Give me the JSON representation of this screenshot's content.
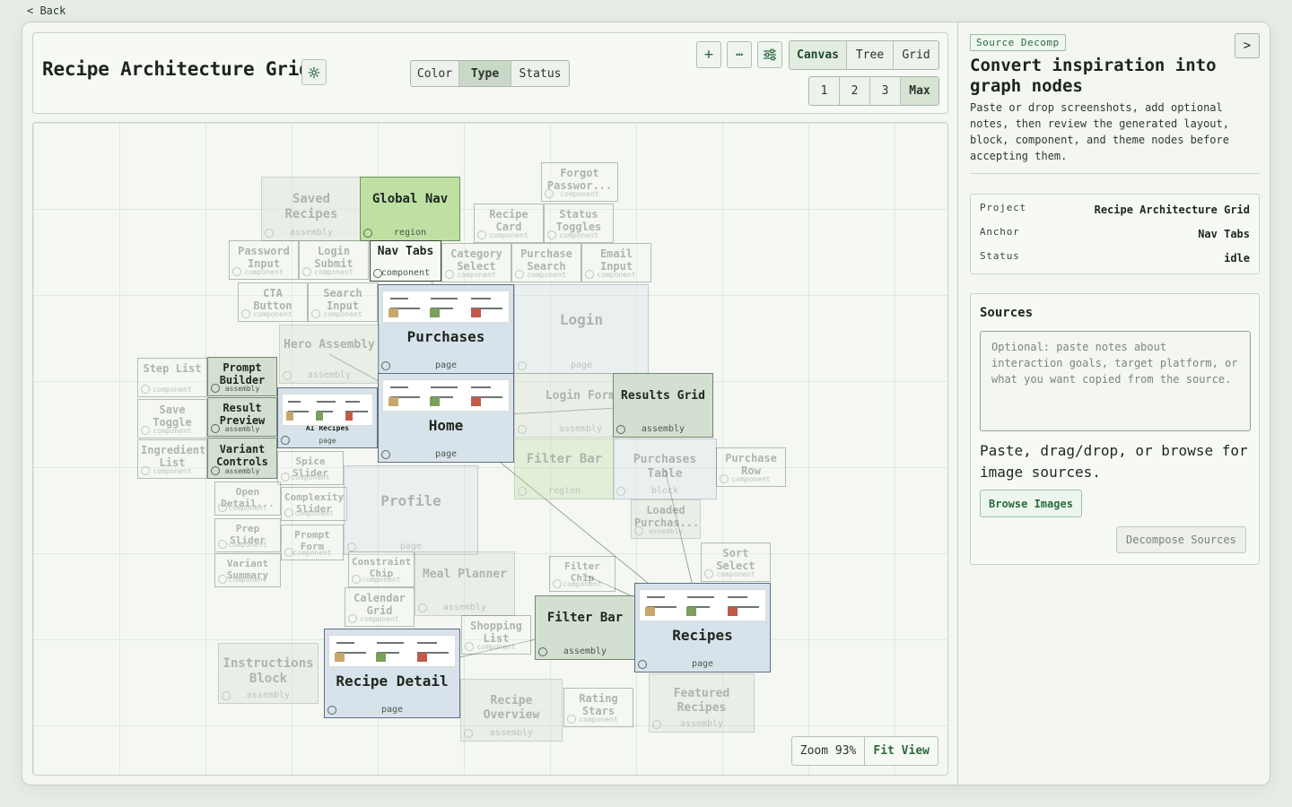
{
  "back": {
    "label": "< Back"
  },
  "header": {
    "title": "Recipe Architecture Grid",
    "color_modes": [
      {
        "label": "Color",
        "active": false
      },
      {
        "label": "Type",
        "active": true
      },
      {
        "label": "Status",
        "active": false
      }
    ],
    "actions": {
      "add": "+",
      "more": "⋯"
    },
    "view_modes": [
      {
        "label": "Canvas",
        "active": true
      },
      {
        "label": "Tree",
        "active": false
      },
      {
        "label": "Grid",
        "active": false
      }
    ],
    "depths": [
      {
        "label": "1",
        "active": false
      },
      {
        "label": "2",
        "active": false
      },
      {
        "label": "3",
        "active": false
      },
      {
        "label": "Max",
        "active": true
      }
    ]
  },
  "canvas": {
    "zoom_label": "Zoom 93%",
    "fit_label": "Fit View",
    "nodes": [
      {
        "id": "saved-recipes",
        "title": "Saved Recipes",
        "type": "assembly",
        "kind": "assembly",
        "faded": true
      },
      {
        "id": "global-nav",
        "title": "Global Nav",
        "type": "region",
        "kind": "region",
        "faded": false
      },
      {
        "id": "forgot-password",
        "title": "Forgot Passwor...",
        "type": "component",
        "kind": "component",
        "faded": true
      },
      {
        "id": "recipe-card",
        "title": "Recipe Card",
        "type": "component",
        "kind": "component",
        "faded": true
      },
      {
        "id": "status-toggles",
        "title": "Status Toggles",
        "type": "component",
        "kind": "component",
        "faded": true
      },
      {
        "id": "password-input",
        "title": "Password Input",
        "type": "component",
        "kind": "component",
        "faded": true
      },
      {
        "id": "login-submit",
        "title": "Login Submit",
        "type": "component",
        "kind": "component",
        "faded": true
      },
      {
        "id": "nav-tabs",
        "title": "Nav Tabs",
        "type": "component",
        "kind": "component",
        "faded": false
      },
      {
        "id": "category-select",
        "title": "Category Select",
        "type": "component",
        "kind": "component",
        "faded": true
      },
      {
        "id": "purchase-search",
        "title": "Purchase Search",
        "type": "component",
        "kind": "component",
        "faded": true
      },
      {
        "id": "email-input",
        "title": "Email Input",
        "type": "component",
        "kind": "component",
        "faded": true
      },
      {
        "id": "cta-button",
        "title": "CTA Button",
        "type": "component",
        "kind": "component",
        "faded": true
      },
      {
        "id": "search-input",
        "title": "Search Input",
        "type": "component",
        "kind": "component",
        "faded": true
      },
      {
        "id": "purchases",
        "title": "Purchases",
        "type": "page",
        "kind": "page",
        "faded": false,
        "thumb": true
      },
      {
        "id": "login",
        "title": "Login",
        "type": "page",
        "kind": "page",
        "faded": true
      },
      {
        "id": "hero-assembly",
        "title": "Hero Assembly",
        "type": "assembly",
        "kind": "assembly",
        "faded": true
      },
      {
        "id": "step-list",
        "title": "Step List",
        "type": "component",
        "kind": "component",
        "faded": true
      },
      {
        "id": "prompt-builder",
        "title": "Prompt Builder",
        "type": "assembly",
        "kind": "assembly",
        "faded": false
      },
      {
        "id": "result-preview",
        "title": "Result Preview",
        "type": "assembly",
        "kind": "assembly",
        "faded": false
      },
      {
        "id": "variant-controls",
        "title": "Variant Controls",
        "type": "assembly",
        "kind": "assembly",
        "faded": false
      },
      {
        "id": "ai-recipes",
        "title": "AI Recipes",
        "type": "page",
        "kind": "page",
        "faded": false,
        "thumb": true
      },
      {
        "id": "home",
        "title": "Home",
        "type": "page",
        "kind": "page",
        "faded": false,
        "thumb": true
      },
      {
        "id": "login-form",
        "title": "Login Form",
        "type": "assembly",
        "kind": "assembly",
        "faded": true
      },
      {
        "id": "results-grid",
        "title": "Results Grid",
        "type": "assembly",
        "kind": "assembly",
        "faded": false
      },
      {
        "id": "save-toggle",
        "title": "Save Toggle",
        "type": "component",
        "kind": "component",
        "faded": true
      },
      {
        "id": "ingredient-list",
        "title": "Ingredient List",
        "type": "component",
        "kind": "component",
        "faded": true
      },
      {
        "id": "spice-slider",
        "title": "Spice Slider",
        "type": "component",
        "kind": "component",
        "faded": true
      },
      {
        "id": "filter-bar-region",
        "title": "Filter Bar",
        "type": "region",
        "kind": "region",
        "faded": true
      },
      {
        "id": "purchases-table",
        "title": "Purchases Table",
        "type": "block",
        "kind": "page",
        "faded": true
      },
      {
        "id": "purchase-row",
        "title": "Purchase Row",
        "type": "component",
        "kind": "component",
        "faded": true
      },
      {
        "id": "open-details",
        "title": "Open Detail...",
        "type": "component",
        "kind": "component",
        "faded": true
      },
      {
        "id": "complexity-slider",
        "title": "Complexity Slider",
        "type": "component",
        "kind": "component",
        "faded": true
      },
      {
        "id": "profile",
        "title": "Profile",
        "type": "page",
        "kind": "page",
        "faded": true
      },
      {
        "id": "loaded-purchases",
        "title": "Loaded Purchas...",
        "type": "assembly",
        "kind": "assembly",
        "faded": true
      },
      {
        "id": "prep-slider",
        "title": "Prep Slider",
        "type": "component",
        "kind": "component",
        "faded": true
      },
      {
        "id": "prompt-form",
        "title": "Prompt Form",
        "type": "component",
        "kind": "component",
        "faded": true
      },
      {
        "id": "sort-select",
        "title": "Sort Select",
        "type": "component",
        "kind": "component",
        "faded": true
      },
      {
        "id": "variant-summary",
        "title": "Variant Summary",
        "type": "component",
        "kind": "component",
        "faded": true
      },
      {
        "id": "constraint-chip",
        "title": "Constraint Chip",
        "type": "component",
        "kind": "component",
        "faded": true
      },
      {
        "id": "meal-planner",
        "title": "Meal Planner",
        "type": "assembly",
        "kind": "assembly",
        "faded": true
      },
      {
        "id": "filter-chip",
        "title": "Filter Chip",
        "type": "component",
        "kind": "component",
        "faded": true
      },
      {
        "id": "filter-bar",
        "title": "Filter Bar",
        "type": "assembly",
        "kind": "assembly",
        "faded": false
      },
      {
        "id": "recipes",
        "title": "Recipes",
        "type": "page",
        "kind": "page",
        "faded": false,
        "thumb": true
      },
      {
        "id": "calendar-grid",
        "title": "Calendar Grid",
        "type": "component",
        "kind": "component",
        "faded": true
      },
      {
        "id": "shopping-list",
        "title": "Shopping List",
        "type": "component",
        "kind": "component",
        "faded": true
      },
      {
        "id": "instructions-block",
        "title": "Instructions Block",
        "type": "assembly",
        "kind": "assembly",
        "faded": true
      },
      {
        "id": "recipe-detail",
        "title": "Recipe Detail",
        "type": "page",
        "kind": "page",
        "faded": false,
        "thumb": true
      },
      {
        "id": "recipe-overview",
        "title": "Recipe Overview",
        "type": "assembly",
        "kind": "assembly",
        "faded": true
      },
      {
        "id": "rating-stars",
        "title": "Rating Stars",
        "type": "component",
        "kind": "component",
        "faded": true
      },
      {
        "id": "featured-recipes",
        "title": "Featured Recipes",
        "type": "assembly",
        "kind": "assembly",
        "faded": true
      }
    ],
    "edges": [
      [
        "purchases",
        "global-nav"
      ],
      [
        "home",
        "hero-assembly"
      ],
      [
        "home",
        "results-grid"
      ],
      [
        "home",
        "recipes"
      ],
      [
        "recipes",
        "purchases-table"
      ],
      [
        "recipes",
        "filter-chip"
      ],
      [
        "recipes",
        "filter-bar"
      ],
      [
        "filter-bar",
        "recipe-detail"
      ]
    ]
  },
  "panel": {
    "tag": "Source Decomp",
    "collapse_label": ">",
    "heading": "Convert inspiration into graph nodes",
    "description": "Paste or drop screenshots, add optional notes, then review the generated layout, block, component, and theme nodes before accepting them.",
    "meta": [
      {
        "key": "Project",
        "value": "Recipe Architecture Grid"
      },
      {
        "key": "Anchor",
        "value": "Nav Tabs"
      },
      {
        "key": "Status",
        "value": "idle"
      }
    ],
    "sources_title": "Sources",
    "notes_placeholder": "Optional: paste notes about interaction goals, target platform, or what you want copied from the source.",
    "drop_hint": "Paste, drag/drop, or browse for image sources.",
    "browse_label": "Browse Images",
    "decompose_label": "Decompose Sources"
  },
  "colors": {
    "accent": "#2a6b3c",
    "page_node": "#d8e2ea",
    "region_node": "#bfe0a3",
    "assembly_node": "#d3dfd1",
    "component_node": "#f7f9f5"
  }
}
